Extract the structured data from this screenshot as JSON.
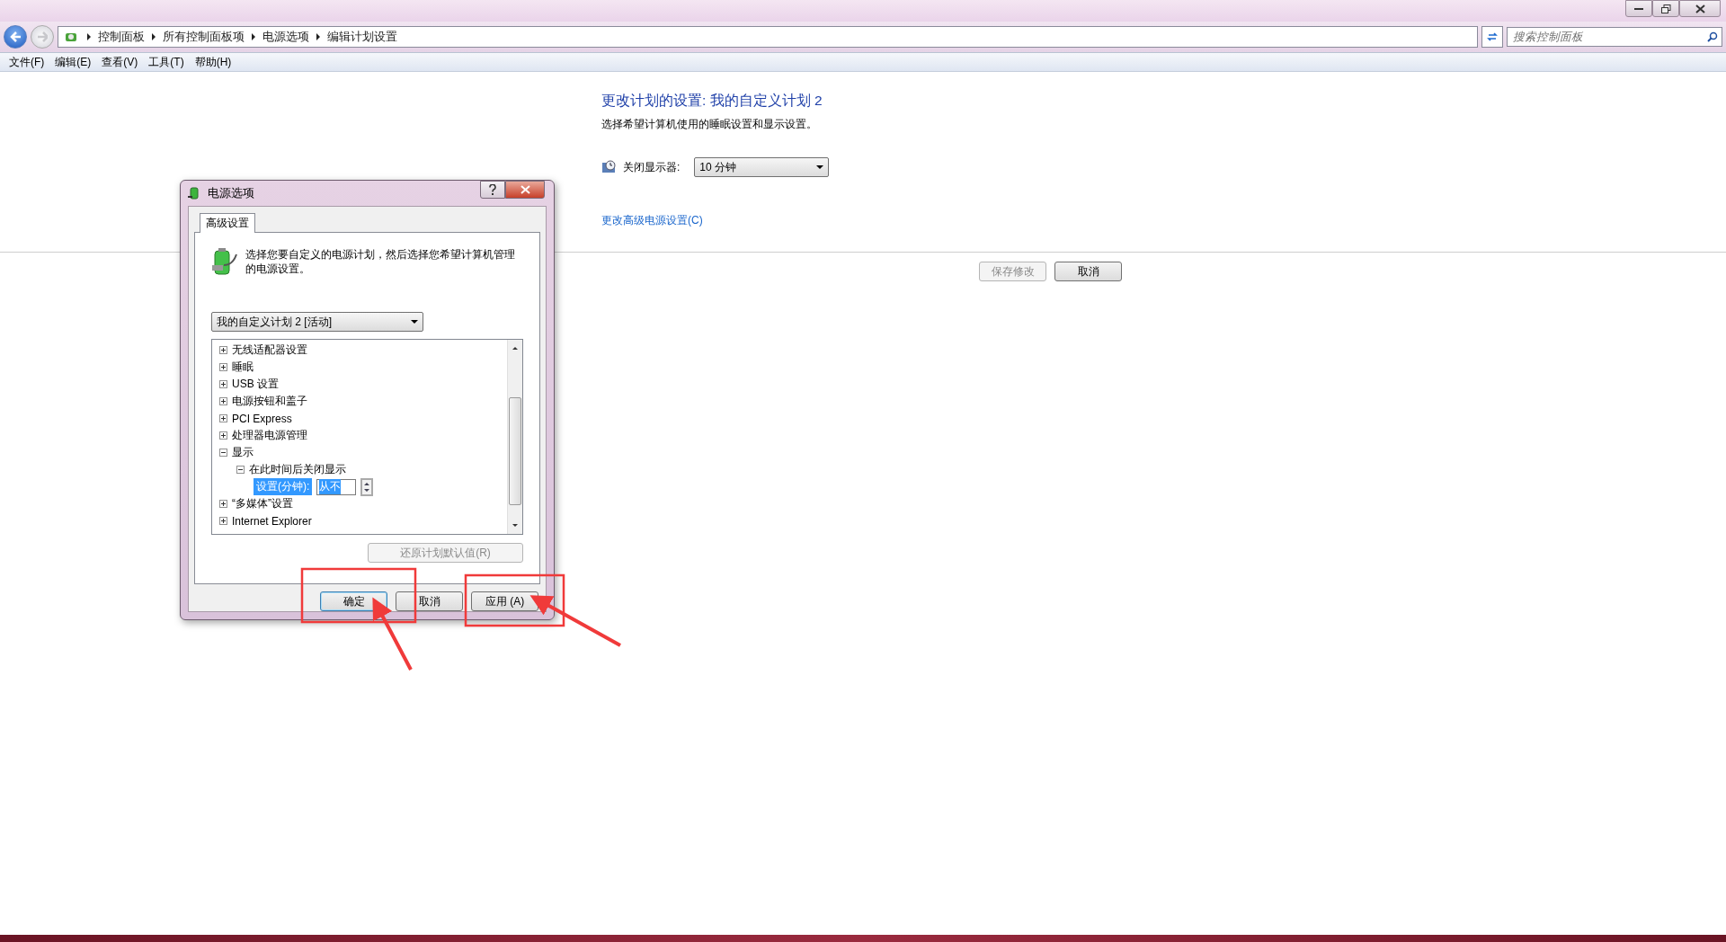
{
  "address_bar": {
    "breadcrumbs": [
      "控制面板",
      "所有控制面板项",
      "电源选项",
      "编辑计划设置"
    ]
  },
  "search": {
    "placeholder": "搜索控制面板"
  },
  "menu": [
    "文件(F)",
    "编辑(E)",
    "查看(V)",
    "工具(T)",
    "帮助(H)"
  ],
  "plan": {
    "title": "更改计划的设置: 我的自定义计划 2",
    "subtitle": "选择希望计算机使用的睡眠设置和显示设置。",
    "display_label": "关闭显示器:",
    "display_value": "10 分钟",
    "advanced_link": "更改高级电源设置(C)",
    "buttons": [
      {
        "label": "保存修改",
        "disabled": true
      },
      {
        "label": "取消",
        "disabled": false
      }
    ]
  },
  "dialog": {
    "title": "电源选项",
    "tabs": [
      {
        "label": "高级设置",
        "selected": true
      }
    ],
    "description": "选择您要自定义的电源计划，然后选择您希望计算机管理的电源设置。",
    "plan_select": "我的自定义计划 2 [活动]",
    "tree": [
      {
        "label": "无线适配器设置",
        "expanded": false
      },
      {
        "label": "睡眠",
        "expanded": false
      },
      {
        "label": "USB 设置",
        "expanded": false
      },
      {
        "label": "电源按钮和盖子",
        "expanded": false
      },
      {
        "label": "PCI Express",
        "expanded": false
      },
      {
        "label": "处理器电源管理",
        "expanded": false
      },
      {
        "label": "显示",
        "expanded": true,
        "children": [
          {
            "label": "在此时间后关闭显示",
            "expanded": true,
            "children": [
              {
                "kind": "setting",
                "label": "设置(分钟):",
                "value": "从不",
                "selected": true
              }
            ]
          }
        ]
      },
      {
        "label": "“多媒体”设置",
        "expanded": false
      },
      {
        "label": "Internet Explorer",
        "expanded": false
      }
    ],
    "restore_button": {
      "label": "还原计划默认值(R)",
      "disabled": true
    },
    "buttons": [
      {
        "label": "确定",
        "default": true
      },
      {
        "label": "取消",
        "default": false
      },
      {
        "label": "应用 (A)",
        "default": false
      }
    ]
  }
}
